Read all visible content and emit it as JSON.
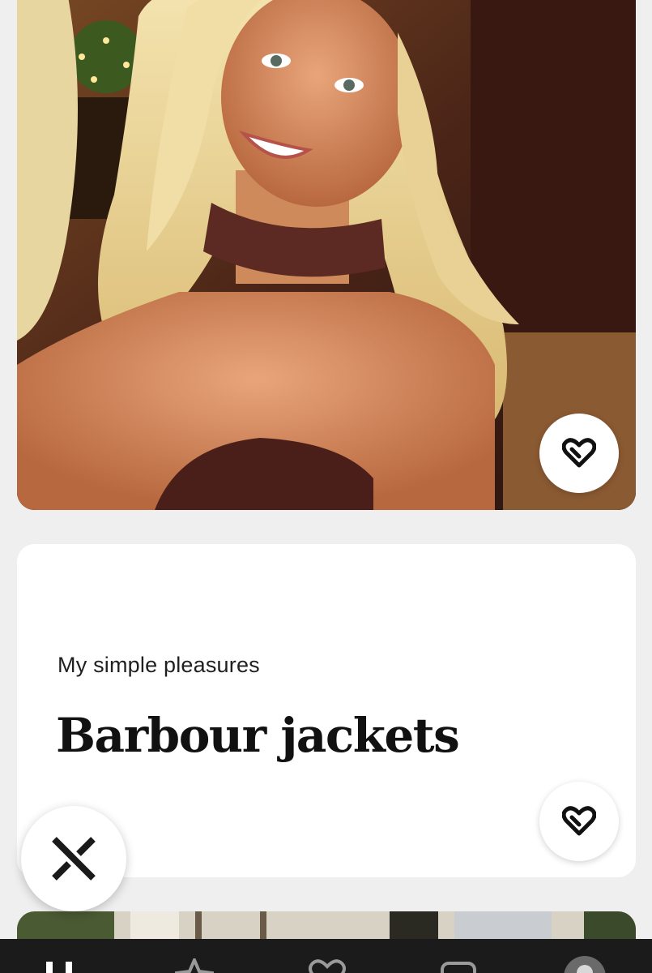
{
  "profile": {
    "prompt_question": "My simple pleasures",
    "prompt_answer": "Barbour jackets"
  },
  "icons": {
    "like": "heart-icon",
    "skip": "close-x-icon",
    "nav": [
      "home-icon",
      "star-icon",
      "heart-icon",
      "chat-icon",
      "avatar"
    ]
  },
  "colors": {
    "background": "#efefef",
    "card": "#ffffff",
    "text_primary": "#111111",
    "nav_bar": "#1b1b1b"
  }
}
